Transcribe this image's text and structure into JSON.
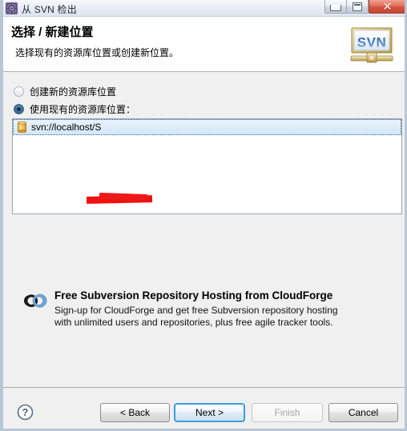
{
  "window": {
    "title": "从 SVN 检出",
    "icon": "svn-checkout-icon",
    "controls": {
      "minimize": "minimize-icon",
      "maximize": "restore-icon",
      "close": "✕"
    }
  },
  "header": {
    "title": "选择 / 新建位置",
    "subtitle": "选择现有的资源库位置或创建新位置。",
    "logo_text": "SVN"
  },
  "options": {
    "create_new": {
      "label": "创建新的资源库位置",
      "checked": false
    },
    "use_existing": {
      "label": "使用现有的资源库位置：",
      "checked": true
    }
  },
  "repository_list": {
    "items": [
      {
        "icon": "repository-icon",
        "label": "svn://localhost/S",
        "redacted": true,
        "selected": true
      }
    ]
  },
  "promo": {
    "icon": "cloudforge-icon",
    "title": "Free Subversion Repository Hosting from CloudForge",
    "line1": "Sign-up for CloudForge and get free Subversion repository hosting",
    "line2": "with unlimited users and repositories, plus free agile tracker tools."
  },
  "footer": {
    "help_icon": "help-icon",
    "buttons": [
      {
        "label": "< Back",
        "state": "enabled"
      },
      {
        "label": "Next >",
        "state": "default-focused"
      },
      {
        "label": "Finish",
        "state": "disabled"
      },
      {
        "label": "Cancel",
        "state": "enabled"
      }
    ]
  },
  "colors": {
    "accent_blue": "#3c9ede",
    "selection_blue": "#d3e7fa",
    "close_red": "#d2543f",
    "redaction_red": "#f21111",
    "panel_gray": "#f0f0f0"
  }
}
